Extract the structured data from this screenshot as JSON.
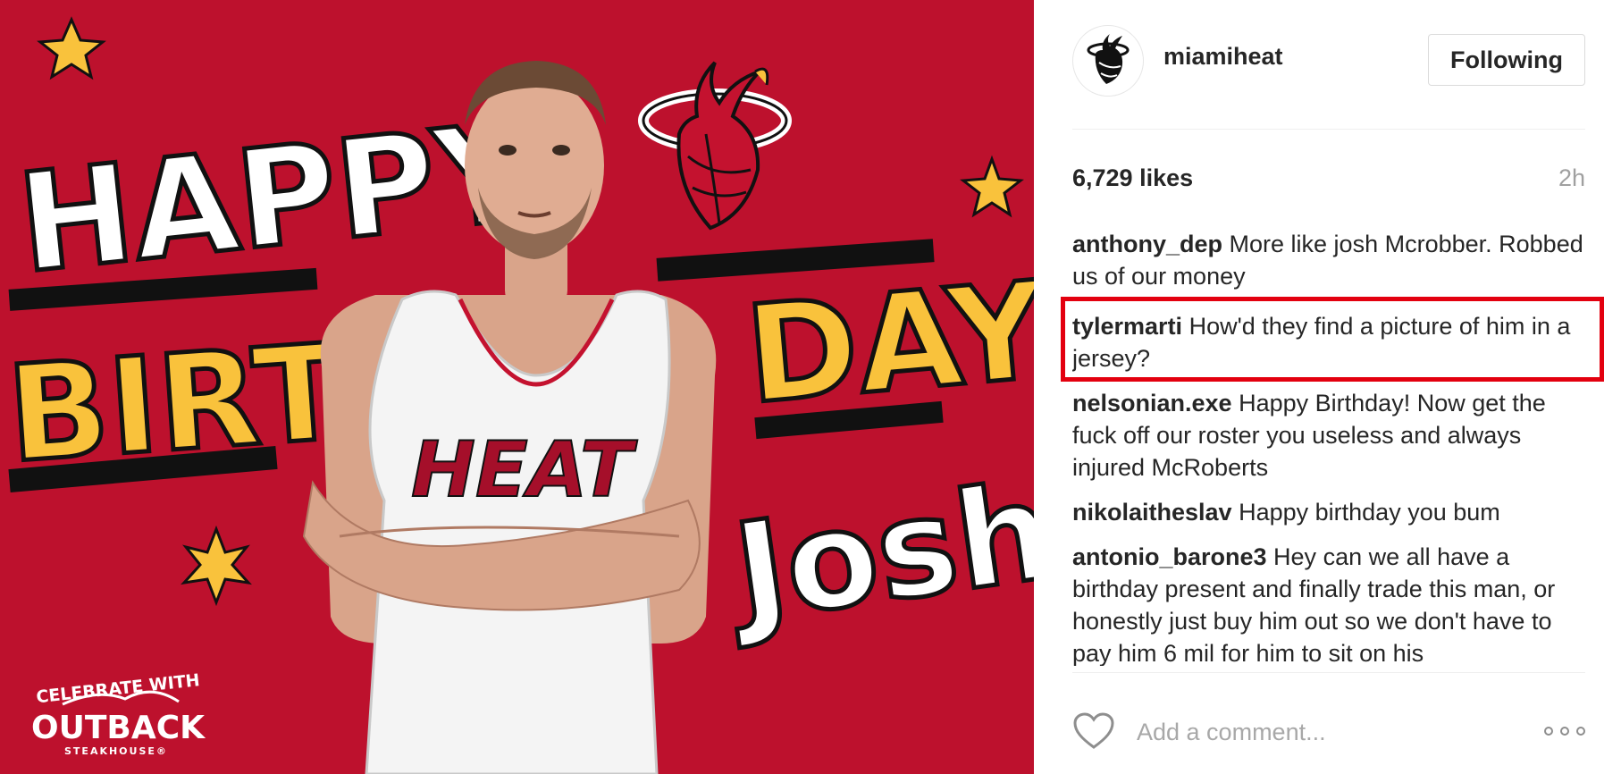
{
  "post_image": {
    "headline_top": "HAPPY",
    "headline_left": "BIRTH",
    "headline_right": "DAY",
    "name": "Josh!",
    "jersey_text": "HEAT",
    "sponsor_line1": "CELEBRATE WITH",
    "sponsor_line2": "OUTBACK",
    "sponsor_line3": "STEAKHOUSE®",
    "colors": {
      "background": "#c4122f",
      "accent_yellow": "#f9c23c",
      "white": "#ffffff",
      "black": "#111111"
    }
  },
  "header": {
    "username": "miamiheat",
    "follow_label": "Following",
    "avatar_icon": "heat-logo-icon"
  },
  "meta": {
    "likes": "6,729 likes",
    "timestamp": "2h"
  },
  "comments": [
    {
      "author": "anthony_dep",
      "text": "More like josh Mcrobber. Robbed us of our money"
    },
    {
      "author": "tylermarti",
      "text": "How'd they find a picture of him in a jersey?",
      "highlighted": true
    },
    {
      "author": "nelsonian.exe",
      "text": "Happy Birthday! Now get the fuck off our roster you useless and always injured McRoberts"
    },
    {
      "author": "nikolaitheslav",
      "text": "Happy birthday you bum"
    },
    {
      "author": "antonio_barone3",
      "text": "Hey can we all have a birthday present and finally trade this man, or honestly just buy him out so we don't have to pay him 6 mil for him to sit on his"
    }
  ],
  "footer": {
    "comment_placeholder": "Add a comment...",
    "heart_icon": "heart-outline-icon",
    "more_icon": "more-options-icon"
  },
  "accent_colors": {
    "highlight_box": "#e3000f",
    "muted_text": "#a0a0a0"
  }
}
